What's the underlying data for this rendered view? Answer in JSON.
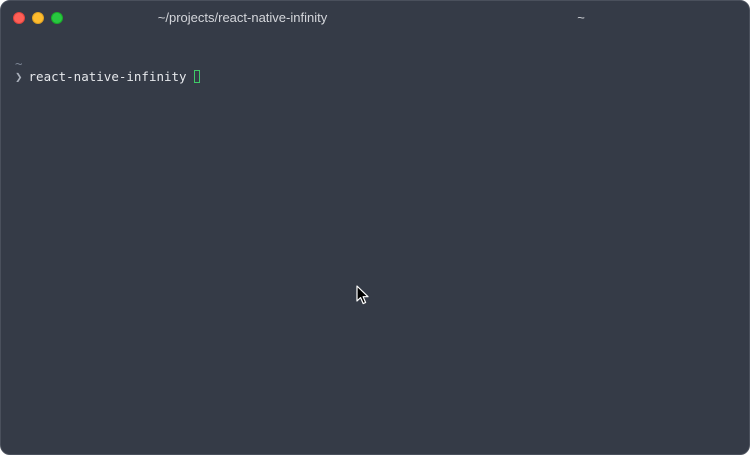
{
  "window": {
    "title": "~/projects/react-native-infinity",
    "tab_label": "~"
  },
  "terminal": {
    "cwd": "~",
    "prompt_symbol": "❯",
    "command": "react-native-infinity"
  },
  "icons": {
    "close": "close-traffic-light",
    "minimize": "minimize-traffic-light",
    "zoom": "zoom-traffic-light",
    "pointer": "mouse-pointer-icon"
  },
  "colors": {
    "background": "#353b47",
    "cursor": "#3fca67",
    "close": "#fe5f57",
    "minimize": "#febc2e",
    "zoom": "#28c840"
  }
}
